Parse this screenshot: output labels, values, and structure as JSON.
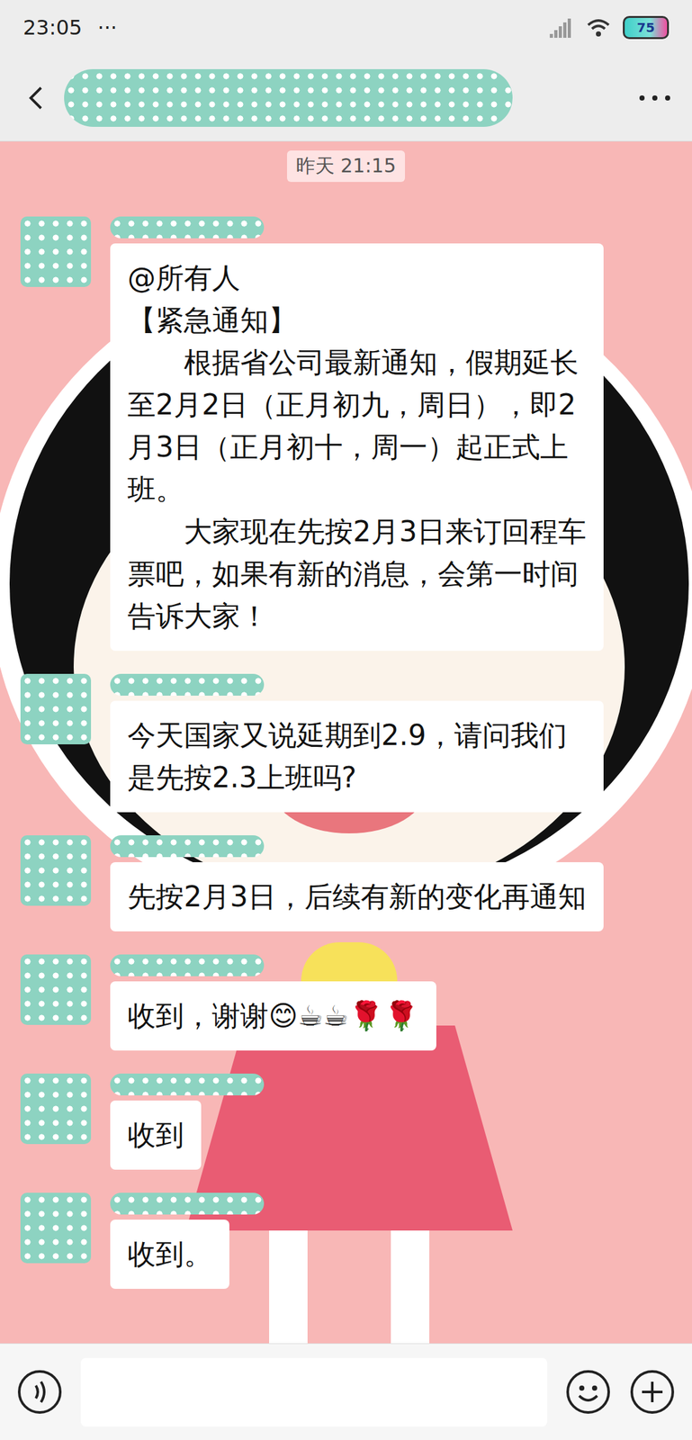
{
  "status_bar": {
    "time": "23:05",
    "more": "···",
    "battery": "75"
  },
  "header": {
    "title_redacted": true
  },
  "timestamp": "昨天 21:15",
  "messages": [
    {
      "sender_redacted": true,
      "paragraphs": [
        {
          "text": "@所有人",
          "indent": false
        },
        {
          "text": "【紧急通知】",
          "indent": false
        },
        {
          "text": "根据省公司最新通知，假期延长至2月2日（正月初九，周日），即2月3日（正月初十，周一）起正式上班。",
          "indent": true
        },
        {
          "text": "大家现在先按2月3日来订回程车票吧，如果有新的消息，会第一时间告诉大家！",
          "indent": true
        }
      ]
    },
    {
      "sender_redacted": true,
      "paragraphs": [
        {
          "text": "今天国家又说延期到2.9，请问我们是先按2.3上班吗?",
          "indent": false
        }
      ]
    },
    {
      "sender_redacted": true,
      "paragraphs": [
        {
          "text": "先按2月3日，后续有新的变化再通知",
          "indent": false
        }
      ]
    },
    {
      "sender_redacted": true,
      "paragraphs": [
        {
          "text": "收到，谢谢😊☕☕🌹🌹",
          "indent": false
        }
      ]
    },
    {
      "sender_redacted": true,
      "paragraphs": [
        {
          "text": "收到",
          "indent": false
        }
      ]
    },
    {
      "sender_redacted": true,
      "paragraphs": [
        {
          "text": "收到。",
          "indent": false
        }
      ]
    }
  ]
}
